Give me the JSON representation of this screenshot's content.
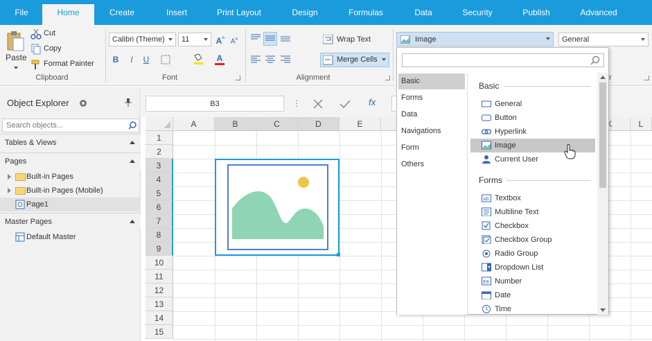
{
  "tabs": [
    "File",
    "Home",
    "Create",
    "Insert",
    "Print Layout",
    "Design",
    "Formulas",
    "Data",
    "Security",
    "Publish",
    "Advanced"
  ],
  "active_tab": "Home",
  "colors": {
    "accent": "#1a9bdc",
    "ribbon_bg": "#f3f3f3",
    "selection": "#c8c8c8"
  },
  "clipboard": {
    "paste": "Paste",
    "cut": "Cut",
    "copy": "Copy",
    "format_painter": "Format Painter",
    "label": "Clipboard"
  },
  "font": {
    "name": "Calibri (Theme)",
    "size": "11",
    "label": "Font",
    "bold": "B",
    "italic": "I",
    "underline": "U"
  },
  "alignment": {
    "wrap": "Wrap Text",
    "merge": "Merge Cells",
    "label": "Alignment"
  },
  "widget_select": {
    "value": "Image"
  },
  "number_format": {
    "value": "General"
  },
  "object_explorer": {
    "title": "Object Explorer",
    "search_placeholder": "Search objects...",
    "sections": {
      "tables": "Tables & Views",
      "pages": "Pages",
      "master": "Master Pages"
    },
    "pages": [
      "Built-in Pages",
      "Built-in Pages (Mobile)",
      "Page1"
    ],
    "masters": [
      "Default Master"
    ]
  },
  "formula_bar": {
    "cell": "B3",
    "fx": "fx"
  },
  "grid": {
    "columns": [
      "A",
      "B",
      "C",
      "D",
      "E",
      "K",
      "L"
    ],
    "rows": [
      "1",
      "2",
      "3",
      "4",
      "5",
      "6",
      "7",
      "8",
      "9",
      "10",
      "11",
      "12",
      "13",
      "14",
      "15"
    ],
    "selected_columns": [
      "B",
      "C",
      "D"
    ],
    "selected_rows": [
      "3",
      "4",
      "5",
      "6",
      "7",
      "8",
      "9"
    ]
  },
  "dropdown": {
    "categories": [
      "Basic",
      "Forms",
      "Data",
      "Navigations",
      "Form",
      "Others"
    ],
    "selected_category": "Basic",
    "basic_heading": "Basic",
    "basic_items": [
      "General",
      "Button",
      "Hyperlink",
      "Image",
      "Current User"
    ],
    "selected_item": "Image",
    "forms_heading": "Forms",
    "forms_items": [
      "Textbox",
      "Multiline Text",
      "Checkbox",
      "Checkbox Group",
      "Radio Group",
      "Dropdown List",
      "Number",
      "Date",
      "Time"
    ]
  }
}
